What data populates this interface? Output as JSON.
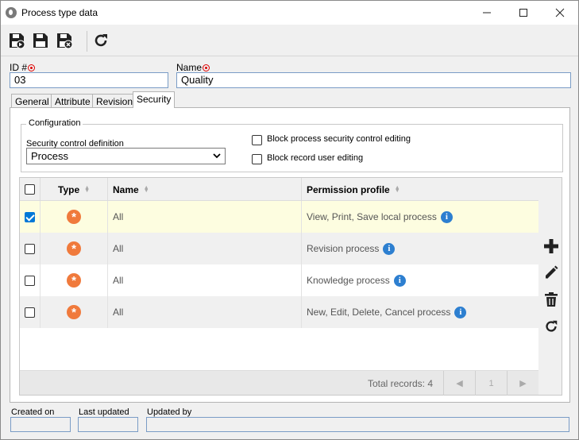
{
  "window": {
    "title": "Process type data"
  },
  "toolbar": {
    "icons": [
      "save-new-icon",
      "save-icon",
      "save-close-icon",
      "refresh-icon"
    ]
  },
  "form": {
    "id_label": "ID #",
    "id_value": "03",
    "name_label": "Name",
    "name_value": "Quality"
  },
  "tabs": [
    {
      "label": "General"
    },
    {
      "label": "Attribute"
    },
    {
      "label": "Revision"
    },
    {
      "label": "Security",
      "active": true
    }
  ],
  "configuration": {
    "legend": "Configuration",
    "security_label": "Security control definition",
    "security_value": "Process",
    "block_process_label": "Block process security control editing",
    "block_record_label": "Block record user editing"
  },
  "grid": {
    "columns": [
      "Type",
      "Name",
      "Permission profile"
    ],
    "rows": [
      {
        "checked": true,
        "name": "All",
        "profile": "View, Print, Save local process"
      },
      {
        "checked": false,
        "name": "All",
        "profile": "Revision process"
      },
      {
        "checked": false,
        "name": "All",
        "profile": "Knowledge process"
      },
      {
        "checked": false,
        "name": "All",
        "profile": "New, Edit, Delete, Cancel process"
      }
    ],
    "total_records": "Total records: 4",
    "page": "1",
    "colors": {
      "selected_row": "#fdfde0",
      "alt_row": "#f0f0f0",
      "type_icon": "#f07a3c",
      "info_icon": "#2d7fd0"
    }
  },
  "footer": {
    "created_on_label": "Created on",
    "last_updated_label": "Last updated",
    "updated_by_label": "Updated by"
  }
}
